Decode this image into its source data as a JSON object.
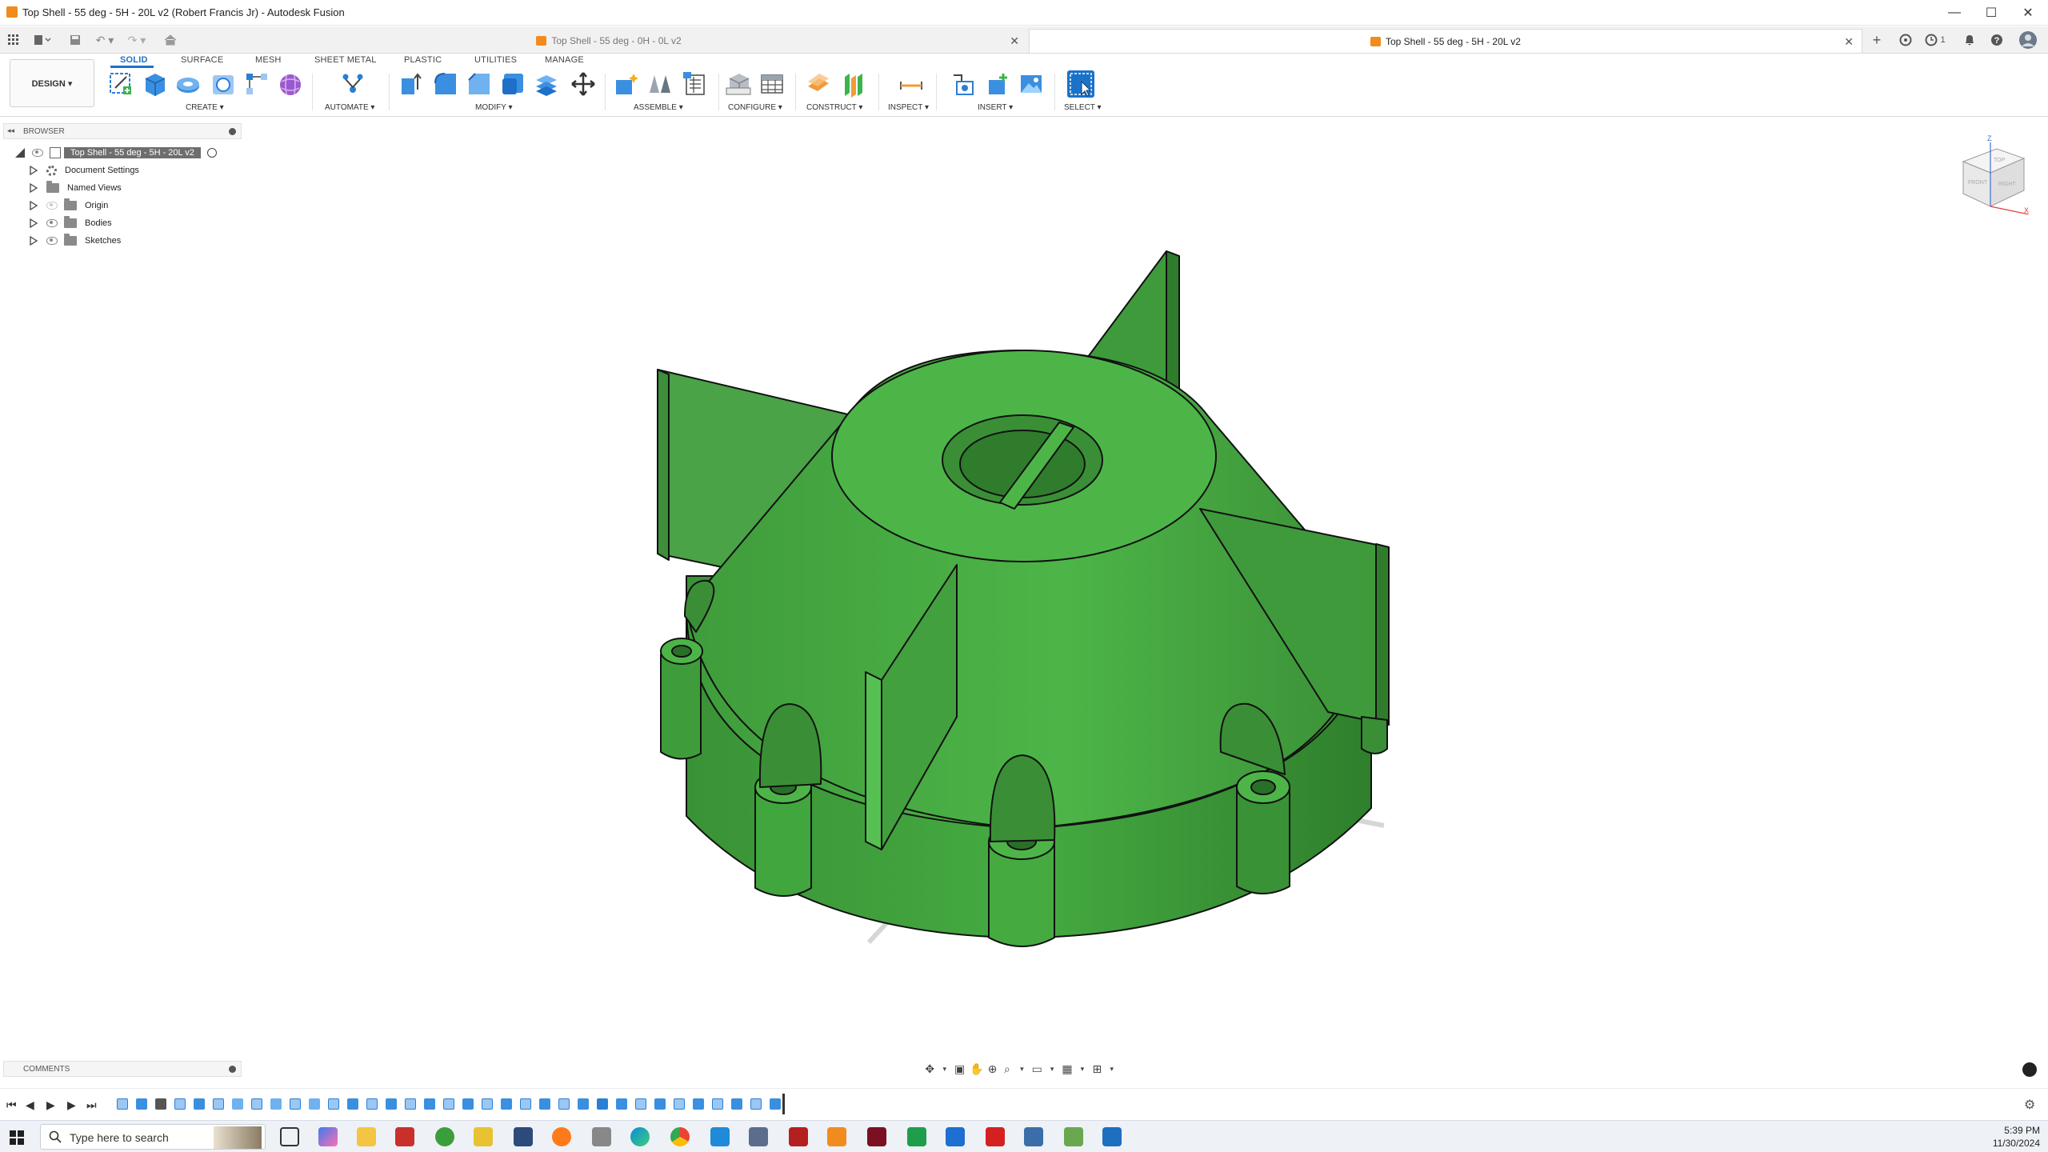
{
  "window": {
    "title": "Top Shell - 55 deg - 5H - 20L v2 (Robert Francis Jr) - Autodesk Fusion"
  },
  "tabs": [
    {
      "label": "Top Shell - 55 deg - 0H - 0L v2",
      "active": false
    },
    {
      "label": "Top Shell - 55 deg - 5H - 20L v2",
      "active": true
    }
  ],
  "header_status": {
    "jobs_count": "1"
  },
  "workspace": {
    "label": "DESIGN ▾"
  },
  "ribbon": {
    "tabs": [
      "SOLID",
      "SURFACE",
      "MESH",
      "SHEET METAL",
      "PLASTIC",
      "UTILITIES",
      "MANAGE"
    ],
    "active_tab": "SOLID",
    "groups": {
      "create": "CREATE ▾",
      "automate": "AUTOMATE ▾",
      "modify": "MODIFY ▾",
      "assemble": "ASSEMBLE ▾",
      "configure": "CONFIGURE ▾",
      "construct": "CONSTRUCT ▾",
      "inspect": "INSPECT ▾",
      "insert": "INSERT ▾",
      "select": "SELECT ▾"
    }
  },
  "browser": {
    "title": "BROWSER",
    "root": "Top Shell - 55 deg - 5H - 20L v2",
    "items": [
      {
        "label": "Document Settings",
        "icon": "gear-icon"
      },
      {
        "label": "Named Views",
        "icon": "folder-icon"
      },
      {
        "label": "Origin",
        "icon": "folder-icon"
      },
      {
        "label": "Bodies",
        "icon": "folder-icon"
      },
      {
        "label": "Sketches",
        "icon": "folder-icon"
      }
    ]
  },
  "comments": {
    "title": "COMMENTS"
  },
  "viewcube": {
    "top": "TOP",
    "front": "FRONT",
    "right": "RIGHT",
    "axis_z": "Z",
    "axis_x": "X"
  },
  "model": {
    "color": "#4caf50",
    "edge_color": "#111111"
  },
  "taskbar": {
    "search_placeholder": "Type here to search",
    "time": "5:39 PM",
    "date": "11/30/2024"
  },
  "colors": {
    "accent": "#1a73c9",
    "model_green": "#4caf50",
    "app_orange": "#f28b1e"
  }
}
